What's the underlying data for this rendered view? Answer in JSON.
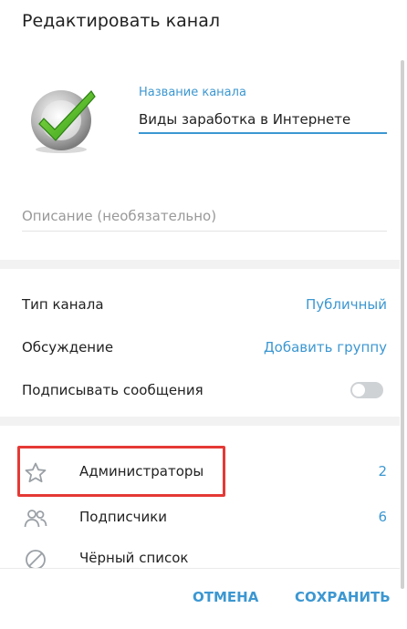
{
  "dialog": {
    "title": "Редактировать канал"
  },
  "channel": {
    "name_label": "Название канала",
    "name_value": "Виды заработка в Интернете",
    "description_placeholder": "Описание (необязательно)"
  },
  "settings": {
    "type_label": "Тип канала",
    "type_value": "Публичный",
    "discussion_label": "Обсуждение",
    "discussion_value": "Добавить группу",
    "sign_label": "Подписывать сообщения",
    "sign_enabled": false
  },
  "lists": [
    {
      "label": "Администраторы",
      "count": "2",
      "icon": "star-icon"
    },
    {
      "label": "Подписчики",
      "count": "6",
      "icon": "users-icon"
    },
    {
      "label": "Чёрный список",
      "count": "",
      "icon": "block-icon"
    }
  ],
  "buttons": {
    "cancel": "ОТМЕНА",
    "save": "СОХРАНИТЬ"
  },
  "colors": {
    "accent": "#3c97d1",
    "highlight": "#e53935",
    "avatar_check": "#4caf1e"
  }
}
